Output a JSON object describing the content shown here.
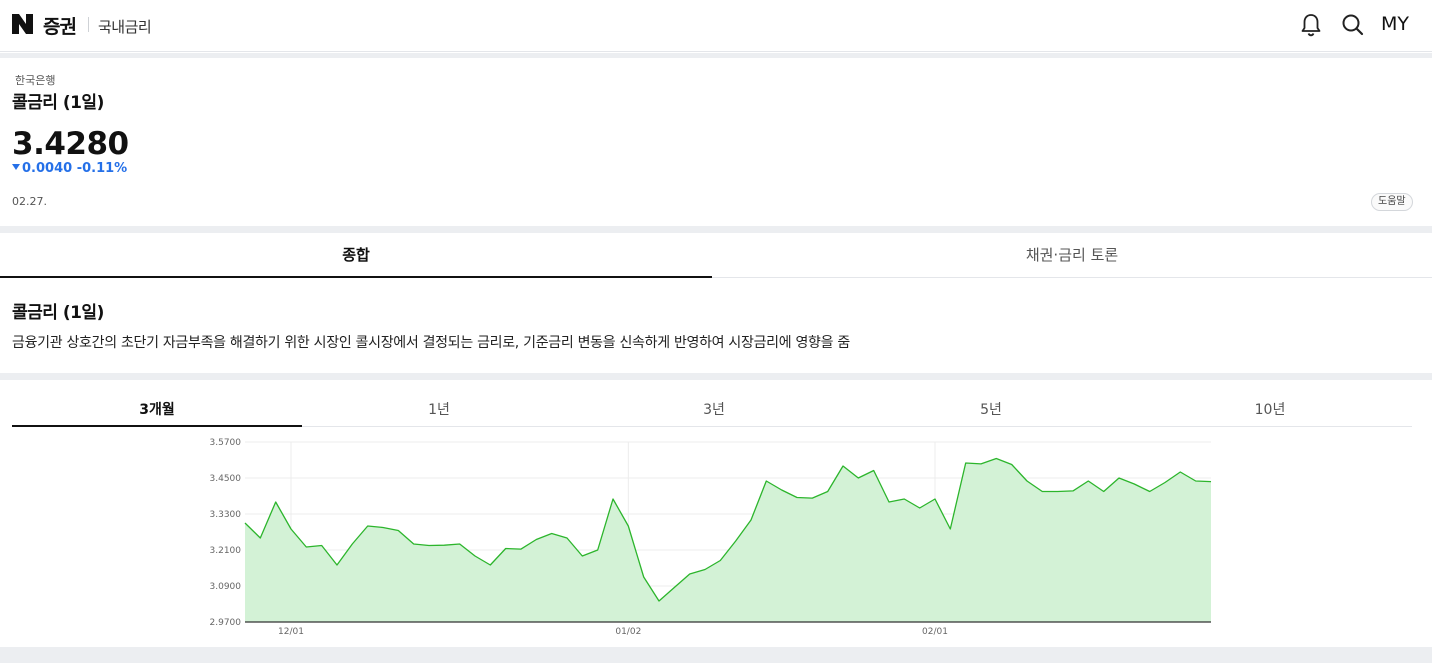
{
  "header": {
    "brand": "증권",
    "section": "국내금리",
    "my_label": "MY",
    "icons": [
      "bell-icon",
      "search-icon"
    ]
  },
  "summary": {
    "issuer": "한국은행",
    "name": "콜금리 (1일)",
    "price": "3.4280",
    "change": "0.0040 -0.11%",
    "change_color": "#2570e8",
    "date": "02.27.",
    "help_label": "도움말"
  },
  "tabs": {
    "overview": "종합",
    "discussion": "채권·금리 토론"
  },
  "description": {
    "title": "콜금리 (1일)",
    "text": "금융기관 상호간의 초단기 자금부족을 해결하기 위한 시장인 콜시장에서 결정되는 금리로, 기준금리 변동을 신속하게 반영하여 시장금리에 영향을 줌"
  },
  "periods": [
    "3개월",
    "1년",
    "3년",
    "5년",
    "10년"
  ],
  "selected_period": "3개월",
  "chart_data": {
    "type": "area",
    "title": "",
    "xlabel": "",
    "ylabel": "",
    "ylim": [
      2.97,
      3.57
    ],
    "yticks": [
      "3.5700",
      "3.4500",
      "3.3300",
      "3.2100",
      "3.0900",
      "2.9700"
    ],
    "xticks": [
      {
        "label": "12/01",
        "index": 3
      },
      {
        "label": "01/02",
        "index": 25
      },
      {
        "label": "02/01",
        "index": 45
      }
    ],
    "color": "#2cb52c",
    "fill": "#d3f2d6",
    "series": [
      {
        "values": [
          3.3,
          3.25,
          3.37,
          3.28,
          3.22,
          3.225,
          3.16,
          3.23,
          3.29,
          3.285,
          3.275,
          3.23,
          3.225,
          3.226,
          3.23,
          3.19,
          3.16,
          3.215,
          3.213,
          3.245,
          3.265,
          3.25,
          3.19,
          3.21,
          3.38,
          3.29,
          3.12,
          3.04,
          3.085,
          3.13,
          3.145,
          3.175,
          3.24,
          3.31,
          3.44,
          3.41,
          3.385,
          3.383,
          3.405,
          3.49,
          3.45,
          3.475,
          3.37,
          3.38,
          3.35,
          3.38,
          3.28,
          3.5,
          3.497,
          3.515,
          3.495,
          3.44,
          3.405,
          3.405,
          3.407,
          3.44,
          3.405,
          3.45,
          3.43,
          3.405,
          3.435,
          3.47,
          3.44,
          3.438
        ]
      }
    ]
  }
}
